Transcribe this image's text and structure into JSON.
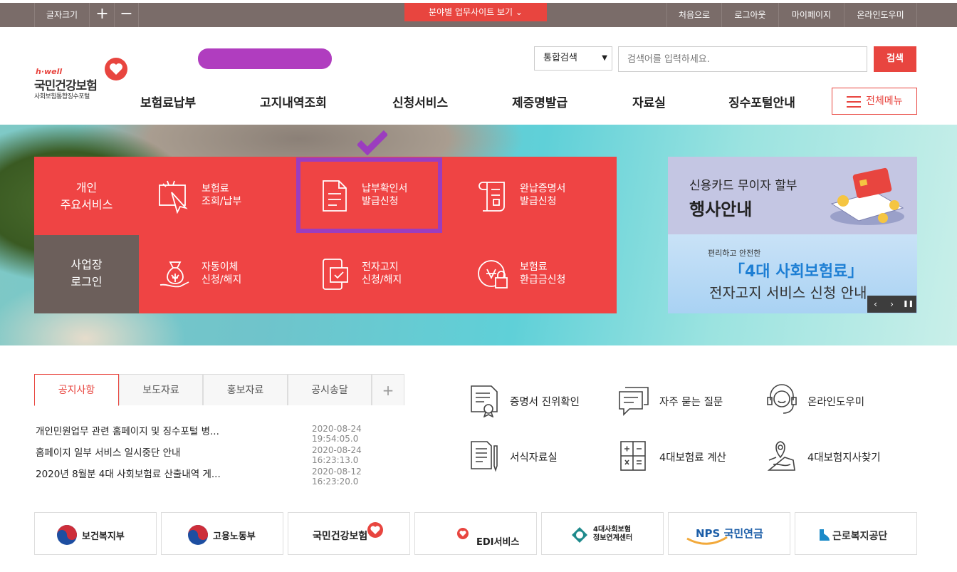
{
  "topbar": {
    "font_size_label": "글자크기",
    "font_increase": "+",
    "font_decrease": "−",
    "field_site_label": "분야별 업무사이트 보기",
    "util_links": [
      "처음으로",
      "로그아웃",
      "마이페이지",
      "온라인도우미"
    ]
  },
  "logo": {
    "brand_small": "h·well",
    "name": "국민건강보험",
    "sub": "사회보험통합징수포털"
  },
  "search": {
    "scope": "통합검색",
    "placeholder": "검색어를 입력하세요.",
    "button": "검색"
  },
  "gnb": [
    "보험료납부",
    "고지내역조회",
    "신청서비스",
    "제증명발급",
    "자료실",
    "징수포털안내"
  ],
  "all_menu": "전체메뉴",
  "services": {
    "group1": "개인\n주요서비스",
    "group2": "사업장\n로그인",
    "items": [
      {
        "line1": "보험료",
        "line2": "조회/납부"
      },
      {
        "line1": "납부확인서",
        "line2": "발급신청"
      },
      {
        "line1": "완납증명서",
        "line2": "발급신청"
      },
      {
        "line1": "자동이체",
        "line2": "신청/해지"
      },
      {
        "line1": "전자고지",
        "line2": "신청/해지"
      },
      {
        "line1": "보험료",
        "line2": "환급금신청"
      }
    ]
  },
  "banners": {
    "ad1": {
      "line1": "신용카드 무이자 할부",
      "line2": "행사안내"
    },
    "ad2": {
      "line1": "편리하고 안전한",
      "line2": "「4대 사회보험료」",
      "line3": "전자고지 서비스 신청 안내"
    },
    "controls": [
      "‹",
      "›",
      "❚❚"
    ]
  },
  "tabs": [
    "공지사항",
    "보도자료",
    "홍보자료",
    "공시송달",
    "+"
  ],
  "news": [
    {
      "title": "개인민원업무 관련 홈페이지 및 징수포털 병...",
      "date": "2020-08-24 19:54:05.0"
    },
    {
      "title": "홈페이지 일부 서비스 일시중단 안내",
      "date": "2020-08-24 16:23:13.0"
    },
    {
      "title": "2020년 8월분 4대 사회보험료 산출내역 게...",
      "date": "2020-08-12 16:23:20.0"
    }
  ],
  "quick_links": [
    "증명서 진위확인",
    "자주 묻는 질문",
    "온라인도우미",
    "서식자료실",
    "4대보험료 계산",
    "4대보험지사찾기"
  ],
  "footer_logos": [
    "보건복지부",
    "고용노동부",
    "국민건강보험",
    "EDI서비스",
    "4대사회보험\n정보연계센터",
    "NPS 국민연금",
    "근로복지공단"
  ],
  "colors": {
    "accent": "#e8453f",
    "topbar": "#7a6c69",
    "highlight": "#9b3dbf"
  }
}
